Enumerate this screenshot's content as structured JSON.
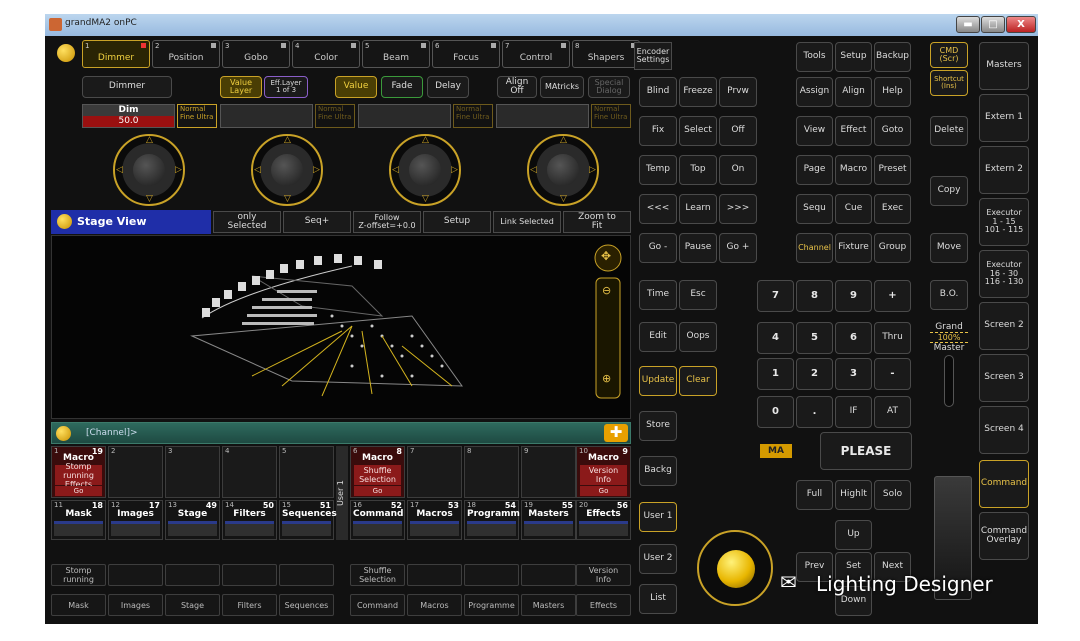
{
  "window": {
    "title": "grandMA2 onPC",
    "min": "▬",
    "max": "□",
    "close": "X"
  },
  "feature_tabs": [
    {
      "num": "1",
      "label": "Dimmer"
    },
    {
      "num": "2",
      "label": "Position"
    },
    {
      "num": "3",
      "label": "Gobo"
    },
    {
      "num": "4",
      "label": "Color"
    },
    {
      "num": "5",
      "label": "Beam"
    },
    {
      "num": "6",
      "label": "Focus"
    },
    {
      "num": "7",
      "label": "Control"
    },
    {
      "num": "8",
      "label": "Shapers"
    }
  ],
  "attr_row": {
    "dimmer": "Dimmer",
    "value_layer": "Value\nLayer",
    "eff_layer": "Eff.Layer\n1 of 3",
    "value": "Value",
    "fade": "Fade",
    "delay": "Delay",
    "align_off": "Align\nOff",
    "matricks": "MAtricks",
    "special_dialog": "Special\nDialog"
  },
  "fader": {
    "label": "Dim",
    "value": "50.0",
    "mode": "Normal\nFine\nUltra"
  },
  "stage_view": {
    "title": "Stage View",
    "buttons": [
      "only\nSelected",
      "Seq+",
      "Follow\nZ-offset=+0.0",
      "Setup",
      "Link Selected",
      "Zoom to\nFit"
    ]
  },
  "command_line": {
    "text": "[Channel]>"
  },
  "executors": [
    {
      "n": "1",
      "c": "19",
      "title": "Macro",
      "sub": "Stomp\nrunning\nEffects",
      "go": "Go",
      "red": true
    },
    {
      "n": "2"
    },
    {
      "n": "3"
    },
    {
      "n": "4"
    },
    {
      "n": "5"
    },
    {
      "n": "6",
      "c": "8",
      "title": "Macro",
      "sub": "Shuffle\nSelection",
      "go": "Go",
      "red": true
    },
    {
      "n": "7"
    },
    {
      "n": "8"
    },
    {
      "n": "9"
    },
    {
      "n": "10",
      "c": "9",
      "title": "Macro",
      "sub": "Version\nInfo",
      "go": "Go",
      "red": true
    }
  ],
  "user_label": "User 1",
  "pools": [
    {
      "n": "11",
      "c": "18",
      "t": "Mask"
    },
    {
      "n": "12",
      "c": "17",
      "t": "Images"
    },
    {
      "n": "13",
      "c": "49",
      "t": "Stage"
    },
    {
      "n": "14",
      "c": "50",
      "t": "Filters"
    },
    {
      "n": "15",
      "c": "51",
      "t": "Sequences"
    },
    {
      "n": "16",
      "c": "52",
      "t": "Command"
    },
    {
      "n": "17",
      "c": "53",
      "t": "Macros"
    },
    {
      "n": "18",
      "c": "54",
      "t": "Programm"
    },
    {
      "n": "19",
      "c": "55",
      "t": "Masters"
    },
    {
      "n": "20",
      "c": "56",
      "t": "Effects"
    }
  ],
  "bottom_row1": [
    "Stomp\nrunning",
    "",
    "",
    "",
    "",
    "Shuffle\nSelection",
    "",
    "",
    "",
    "Version\nInfo"
  ],
  "bottom_row2": [
    "Mask",
    "Images",
    "Stage",
    "Filters",
    "Sequences",
    "Command",
    "Macros",
    "Programme",
    "Masters",
    "Effects"
  ],
  "keys_left": [
    "Encoder\nSettings",
    "Blind",
    "Freeze",
    "Prvw",
    "Fix",
    "Select",
    "Off",
    "Temp",
    "Top",
    "On",
    "<<<",
    "Learn",
    ">>>",
    "Go -",
    "Pause",
    "Go +",
    "Time",
    "Esc",
    "Edit",
    "Oops",
    "Update",
    "Clear",
    "Store",
    "Backg",
    "User 1",
    "User 2",
    "List"
  ],
  "keys_right": [
    "Tools",
    "Setup",
    "Backup",
    "Assign",
    "Align",
    "Help",
    "View",
    "Effect",
    "Goto",
    "Page",
    "Macro",
    "Preset",
    "Sequ",
    "Cue",
    "Exec",
    "Channel",
    "Fixture",
    "Group"
  ],
  "numpad": [
    "7",
    "8",
    "9",
    "+",
    "4",
    "5",
    "6",
    "Thru",
    "1",
    "2",
    "3",
    "-",
    "0",
    ".",
    "IF",
    "AT"
  ],
  "please": "PLEASE",
  "ma_logo": "MA",
  "misc": {
    "full": "Full",
    "highlt": "Highlt",
    "solo": "Solo",
    "up": "Up",
    "prev": "Prev",
    "set": "Set",
    "next": "Next",
    "down": "Down"
  },
  "side": {
    "cmd": "CMD\n(Scr)",
    "shortcut": "Shortcut\n(Ins)",
    "delete": "Delete",
    "copy": "Copy",
    "move": "Move",
    "bo": "B.O.",
    "grand": "Grand",
    "pct": "100%",
    "master": "Master"
  },
  "masters": [
    "Masters",
    "Extern 1",
    "Extern 2",
    "Executor\n1 - 15\n101 - 115",
    "Executor\n16 - 30\n116 - 130",
    "Screen 2",
    "Screen 3",
    "Screen 4",
    "Command",
    "Command\nOverlay"
  ],
  "watermark": "Lighting Designer"
}
